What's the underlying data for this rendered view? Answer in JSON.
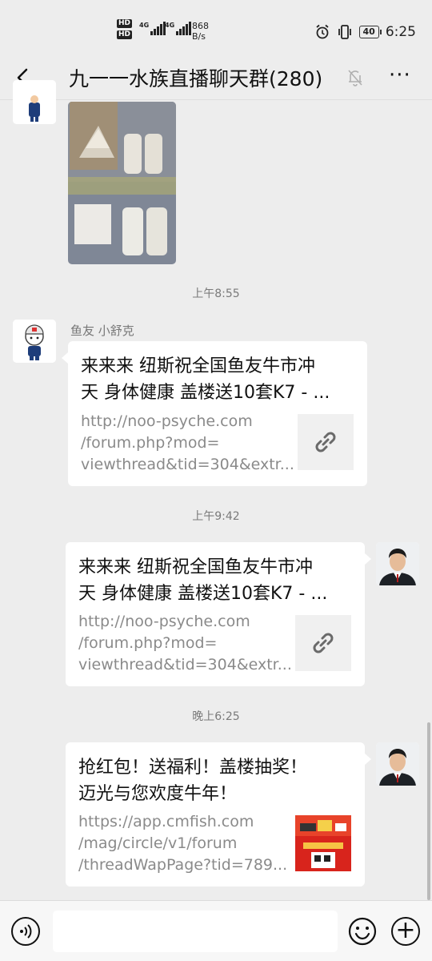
{
  "status_bar": {
    "speed_value": "868",
    "speed_unit": "B/s",
    "battery": "40",
    "time": "6:25",
    "sim1_tag": "HD",
    "sim2_tag": "HD",
    "net1_label": "4G",
    "net2_label": "4G"
  },
  "header": {
    "title": "九一一水族直播聊天群(280)",
    "more_label": "···"
  },
  "messages": {
    "ts1": "上午8:55",
    "sender1": "鱼友 小舒克",
    "card1": {
      "title_line1": "来来来 纽斯祝全国鱼友牛市冲",
      "title_line2": "天 身体健康 盖楼送10套K7 - ...",
      "url_line1": "http://noo-psyche.com",
      "url_line2": "/forum.php?mod=",
      "url_line3": "viewthread&tid=304&extr..."
    },
    "ts2": "上午9:42",
    "card2": {
      "title_line1": "来来来 纽斯祝全国鱼友牛市冲",
      "title_line2": "天 身体健康 盖楼送10套K7 - ...",
      "url_line1": "http://noo-psyche.com",
      "url_line2": "/forum.php?mod=",
      "url_line3": "viewthread&tid=304&extr..."
    },
    "ts3": "晚上6:25",
    "card3": {
      "title_line1": "抢红包！送福利！盖楼抽奖！",
      "title_line2": "迈光与您欢度牛年！",
      "url_line1": "https://app.cmfish.com",
      "url_line2": "/mag/circle/v1/forum",
      "url_line3": "/threadWapPage?tid=789..."
    }
  },
  "icons": {
    "back": "chevron-left-icon",
    "mute": "bell-off-icon",
    "link": "link-icon",
    "voice": "voice-icon",
    "emoji": "smiley-icon",
    "plus": "plus-icon"
  },
  "colors": {
    "background": "#ededed",
    "card": "#ffffff",
    "thumb_bg": "#f0f0f0",
    "timestamp": "#7a7a7a",
    "url_text": "#8a8a8a"
  }
}
